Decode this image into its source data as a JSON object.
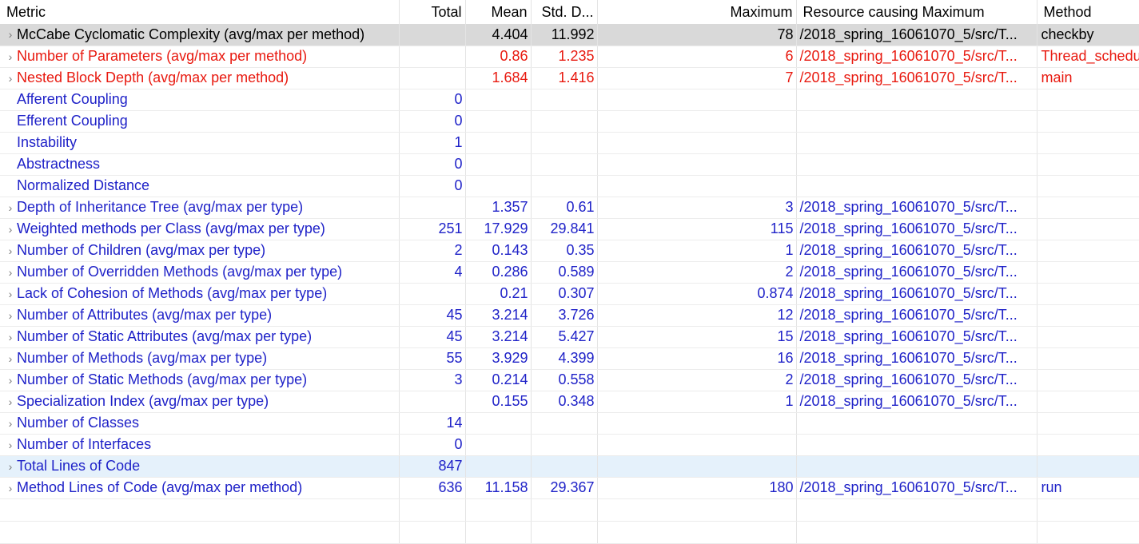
{
  "header": {
    "metric": "Metric",
    "total": "Total",
    "mean": "Mean",
    "std": "Std. D...",
    "max": "Maximum",
    "resource": "Resource causing Maximum",
    "method": "Method"
  },
  "rows": [
    {
      "metric": "McCabe Cyclomatic Complexity (avg/max per method)",
      "total": "",
      "mean": "4.404",
      "std": "11.992",
      "max": "78",
      "resource": "/2018_spring_16061070_5/src/T...",
      "method": "checkby"
    },
    {
      "metric": "Number of Parameters (avg/max per method)",
      "total": "",
      "mean": "0.86",
      "std": "1.235",
      "max": "6",
      "resource": "/2018_spring_16061070_5/src/T...",
      "method": "Thread_schedu"
    },
    {
      "metric": "Nested Block Depth (avg/max per method)",
      "total": "",
      "mean": "1.684",
      "std": "1.416",
      "max": "7",
      "resource": "/2018_spring_16061070_5/src/T...",
      "method": "main"
    },
    {
      "metric": "Afferent Coupling",
      "total": "0",
      "mean": "",
      "std": "",
      "max": "",
      "resource": "",
      "method": ""
    },
    {
      "metric": "Efferent Coupling",
      "total": "0",
      "mean": "",
      "std": "",
      "max": "",
      "resource": "",
      "method": ""
    },
    {
      "metric": "Instability",
      "total": "1",
      "mean": "",
      "std": "",
      "max": "",
      "resource": "",
      "method": ""
    },
    {
      "metric": "Abstractness",
      "total": "0",
      "mean": "",
      "std": "",
      "max": "",
      "resource": "",
      "method": ""
    },
    {
      "metric": "Normalized Distance",
      "total": "0",
      "mean": "",
      "std": "",
      "max": "",
      "resource": "",
      "method": ""
    },
    {
      "metric": "Depth of Inheritance Tree (avg/max per type)",
      "total": "",
      "mean": "1.357",
      "std": "0.61",
      "max": "3",
      "resource": "/2018_spring_16061070_5/src/T...",
      "method": ""
    },
    {
      "metric": "Weighted methods per Class (avg/max per type)",
      "total": "251",
      "mean": "17.929",
      "std": "29.841",
      "max": "115",
      "resource": "/2018_spring_16061070_5/src/T...",
      "method": ""
    },
    {
      "metric": "Number of Children (avg/max per type)",
      "total": "2",
      "mean": "0.143",
      "std": "0.35",
      "max": "1",
      "resource": "/2018_spring_16061070_5/src/T...",
      "method": ""
    },
    {
      "metric": "Number of Overridden Methods (avg/max per type)",
      "total": "4",
      "mean": "0.286",
      "std": "0.589",
      "max": "2",
      "resource": "/2018_spring_16061070_5/src/T...",
      "method": ""
    },
    {
      "metric": "Lack of Cohesion of Methods (avg/max per type)",
      "total": "",
      "mean": "0.21",
      "std": "0.307",
      "max": "0.874",
      "resource": "/2018_spring_16061070_5/src/T...",
      "method": ""
    },
    {
      "metric": "Number of Attributes (avg/max per type)",
      "total": "45",
      "mean": "3.214",
      "std": "3.726",
      "max": "12",
      "resource": "/2018_spring_16061070_5/src/T...",
      "method": ""
    },
    {
      "metric": "Number of Static Attributes (avg/max per type)",
      "total": "45",
      "mean": "3.214",
      "std": "5.427",
      "max": "15",
      "resource": "/2018_spring_16061070_5/src/T...",
      "method": ""
    },
    {
      "metric": "Number of Methods (avg/max per type)",
      "total": "55",
      "mean": "3.929",
      "std": "4.399",
      "max": "16",
      "resource": "/2018_spring_16061070_5/src/T...",
      "method": ""
    },
    {
      "metric": "Number of Static Methods (avg/max per type)",
      "total": "3",
      "mean": "0.214",
      "std": "0.558",
      "max": "2",
      "resource": "/2018_spring_16061070_5/src/T...",
      "method": ""
    },
    {
      "metric": "Specialization Index (avg/max per type)",
      "total": "",
      "mean": "0.155",
      "std": "0.348",
      "max": "1",
      "resource": "/2018_spring_16061070_5/src/T...",
      "method": ""
    },
    {
      "metric": "Number of Classes",
      "total": "14",
      "mean": "",
      "std": "",
      "max": "",
      "resource": "",
      "method": ""
    },
    {
      "metric": "Number of Interfaces",
      "total": "0",
      "mean": "",
      "std": "",
      "max": "",
      "resource": "",
      "method": ""
    },
    {
      "metric": "Total Lines of Code",
      "total": "847",
      "mean": "",
      "std": "",
      "max": "",
      "resource": "",
      "method": ""
    },
    {
      "metric": "Method Lines of Code (avg/max per method)",
      "total": "636",
      "mean": "11.158",
      "std": "29.367",
      "max": "180",
      "resource": "/2018_spring_16061070_5/src/T...",
      "method": "run"
    }
  ],
  "colors": {
    "text_blue": "#1f22c8",
    "text_red": "#e8190f",
    "selected_bg": "#d9d9d9",
    "hover_bg": "#e5f1fb"
  }
}
